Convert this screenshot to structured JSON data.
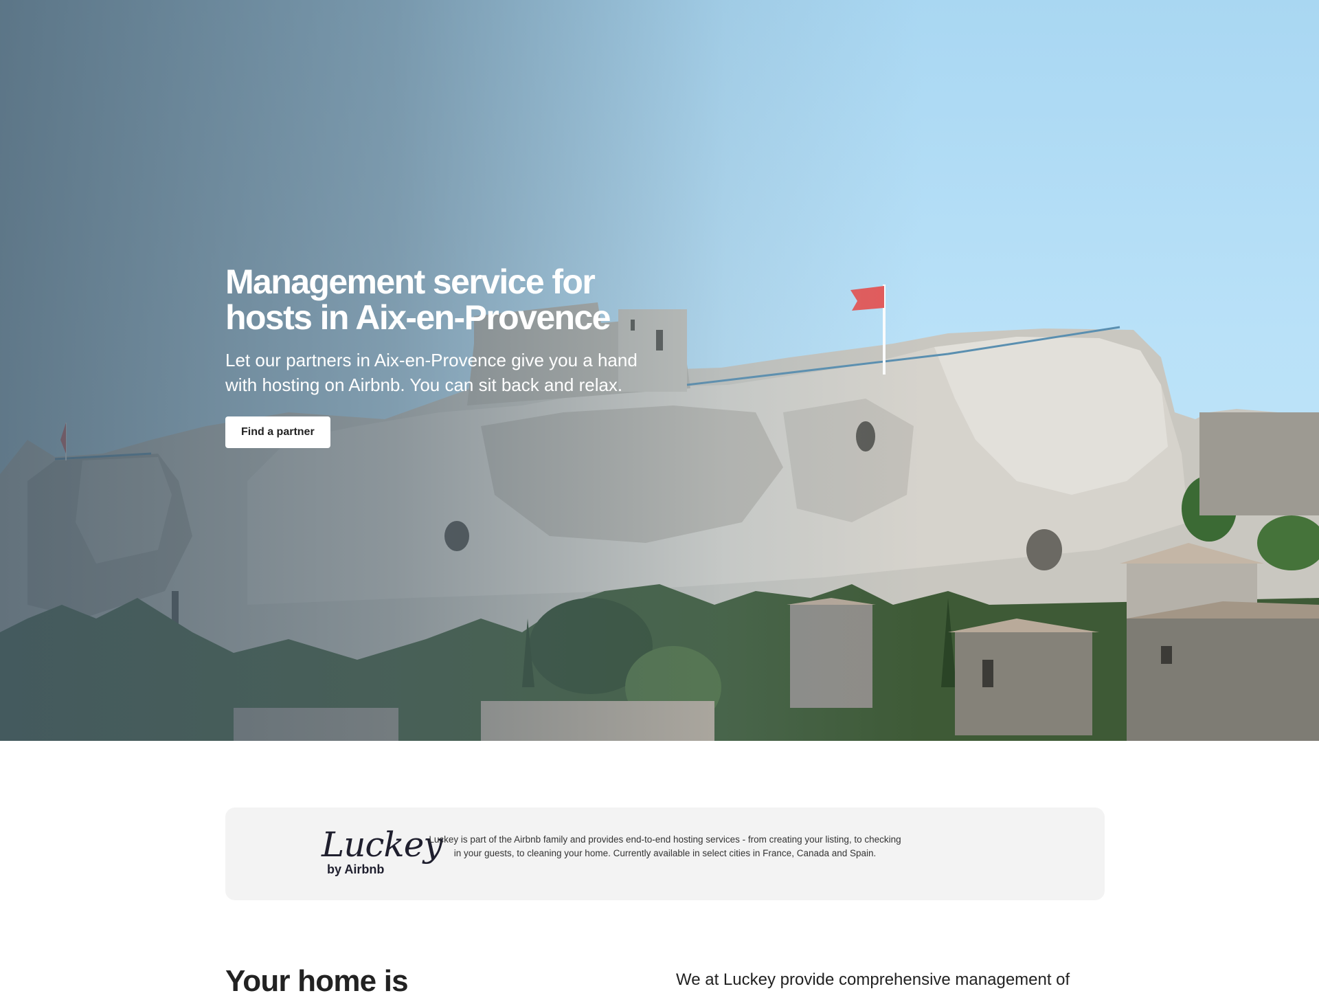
{
  "hero": {
    "title": "Management service for hosts in Aix-en-Provence",
    "subtitle": "Let our partners in Aix-en-Provence give you a hand with hosting on Airbnb. You can sit back and relax.",
    "cta_label": "Find a partner",
    "image_description": "Hilltop castle ruins and stone village under blue sky"
  },
  "luckey": {
    "logo_script": "Luckey",
    "logo_byline": "by Airbnb",
    "description": "Luckey is part of the Airbnb family and provides end-to-end hosting services - from creating your listing, to checking in your guests, to cleaning your home. Currently available in select cities in France, Canada and Spain."
  },
  "section": {
    "heading": "Your home is",
    "intro": "We at Luckey provide comprehensive management of"
  },
  "colors": {
    "sky": "#b4dcf5",
    "button_bg": "#ffffff",
    "banner_bg": "#f3f3f3",
    "text": "#222222"
  }
}
